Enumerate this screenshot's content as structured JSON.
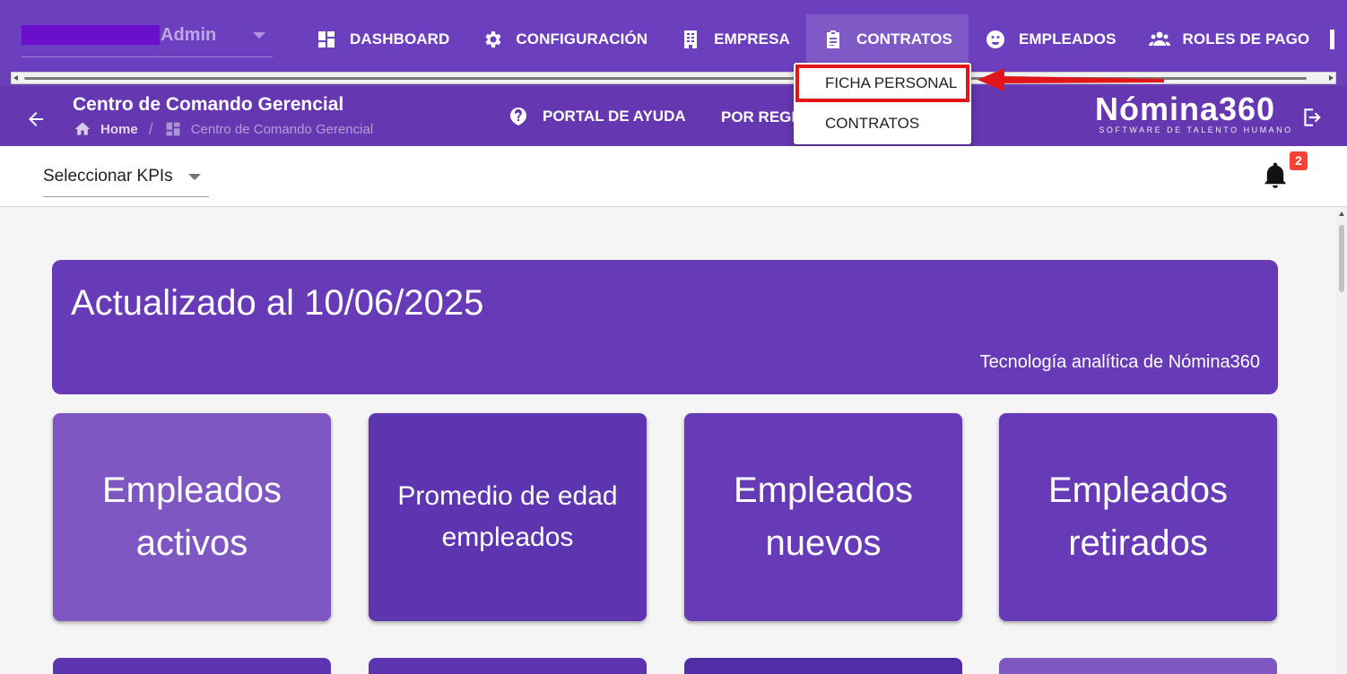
{
  "user": {
    "role": "Admin"
  },
  "nav": {
    "items": [
      {
        "label": "DASHBOARD"
      },
      {
        "label": "CONFIGURACIÓN"
      },
      {
        "label": "EMPRESA"
      },
      {
        "label": "CONTRATOS"
      },
      {
        "label": "EMPLEADOS"
      },
      {
        "label": "ROLES DE PAGO"
      }
    ],
    "active": "CONTRATOS"
  },
  "dropdown": {
    "items": [
      {
        "label": "FICHA PERSONAL"
      },
      {
        "label": "CONTRATOS"
      }
    ]
  },
  "subheader": {
    "title": "Centro de Comando Gerencial",
    "breadcrumb": {
      "home": "Home",
      "current": "Centro de Comando Gerencial"
    },
    "help_link": "PORTAL DE AYUDA",
    "reg_link": "POR REGISTRAR"
  },
  "brand": {
    "name": "Nómina360",
    "tagline": "SOFTWARE DE TALENTO HUMANO"
  },
  "toolbar": {
    "kpi_select": "Seleccionar KPIs",
    "notifications_count": "2"
  },
  "banner": {
    "title": "Actualizado al 10/06/2025",
    "subtitle": "Tecnología analítica de Nómina360"
  },
  "cards": [
    {
      "label": "Empleados activos"
    },
    {
      "label": "Promedio de edad empleados"
    },
    {
      "label": "Empleados nuevos"
    },
    {
      "label": "Empleados retirados"
    }
  ],
  "colors": {
    "primary": "#673ab7",
    "header": "#6b3fbe",
    "highlight": "#e0161b",
    "badge": "#f44336"
  }
}
